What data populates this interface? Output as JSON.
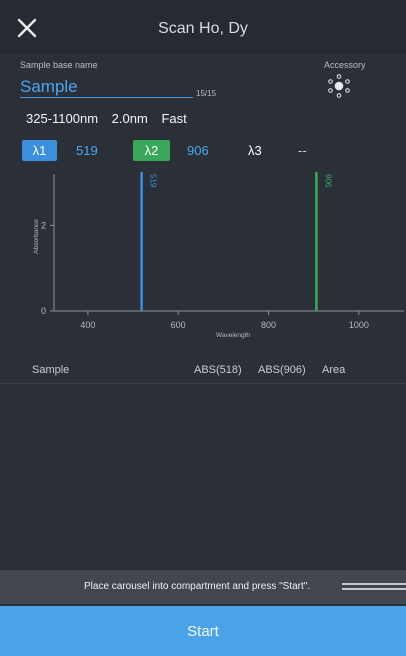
{
  "header": {
    "title": "Scan Ho, Dy"
  },
  "sample": {
    "label": "Sample base name",
    "value": "Sample",
    "count": "15/15"
  },
  "accessory": {
    "label": "Accessory"
  },
  "scan": {
    "range": "325-1100nm",
    "step": "2.0nm",
    "speed": "Fast"
  },
  "lambdas": [
    {
      "label": "λ1",
      "value": "519",
      "color": "#3b8fdc"
    },
    {
      "label": "λ2",
      "value": "906",
      "color": "#3aa85a"
    },
    {
      "label": "λ3",
      "value": "--"
    }
  ],
  "chart_data": {
    "type": "line",
    "xlabel": "Wavelength",
    "ylabel": "Absorbance",
    "xlim": [
      325,
      1100
    ],
    "ylim": [
      0,
      3.2
    ],
    "x_ticks": [
      400,
      600,
      800,
      1000
    ],
    "y_ticks": [
      0,
      2
    ],
    "markers": [
      {
        "label": "519",
        "x": 519,
        "color": "#3b8fdc"
      },
      {
        "label": "906",
        "x": 906,
        "color": "#3aa85a"
      }
    ]
  },
  "table": {
    "columns": [
      "Sample",
      "ABS(518)",
      "ABS(906)",
      "Area"
    ]
  },
  "status": {
    "message": "Place carousel into compartment and press \"Start\"."
  },
  "actions": {
    "start_label": "Start"
  }
}
